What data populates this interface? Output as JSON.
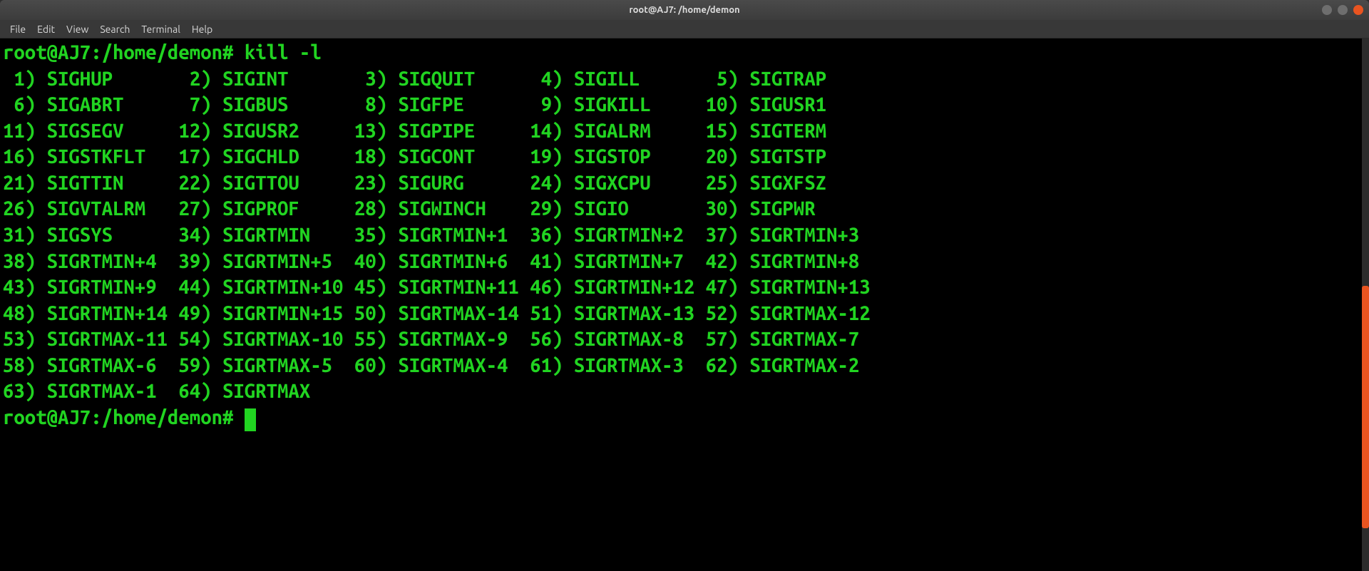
{
  "titlebar": {
    "title": "root@AJ7: /home/demon"
  },
  "menubar": {
    "items": [
      "File",
      "Edit",
      "View",
      "Search",
      "Terminal",
      "Help"
    ]
  },
  "terminal": {
    "prompt": "root@AJ7:/home/demon#",
    "command": "kill -l",
    "signals": [
      {
        "num": "1",
        "name": "SIGHUP"
      },
      {
        "num": "2",
        "name": "SIGINT"
      },
      {
        "num": "3",
        "name": "SIGQUIT"
      },
      {
        "num": "4",
        "name": "SIGILL"
      },
      {
        "num": "5",
        "name": "SIGTRAP"
      },
      {
        "num": "6",
        "name": "SIGABRT"
      },
      {
        "num": "7",
        "name": "SIGBUS"
      },
      {
        "num": "8",
        "name": "SIGFPE"
      },
      {
        "num": "9",
        "name": "SIGKILL"
      },
      {
        "num": "10",
        "name": "SIGUSR1"
      },
      {
        "num": "11",
        "name": "SIGSEGV"
      },
      {
        "num": "12",
        "name": "SIGUSR2"
      },
      {
        "num": "13",
        "name": "SIGPIPE"
      },
      {
        "num": "14",
        "name": "SIGALRM"
      },
      {
        "num": "15",
        "name": "SIGTERM"
      },
      {
        "num": "16",
        "name": "SIGSTKFLT"
      },
      {
        "num": "17",
        "name": "SIGCHLD"
      },
      {
        "num": "18",
        "name": "SIGCONT"
      },
      {
        "num": "19",
        "name": "SIGSTOP"
      },
      {
        "num": "20",
        "name": "SIGTSTP"
      },
      {
        "num": "21",
        "name": "SIGTTIN"
      },
      {
        "num": "22",
        "name": "SIGTTOU"
      },
      {
        "num": "23",
        "name": "SIGURG"
      },
      {
        "num": "24",
        "name": "SIGXCPU"
      },
      {
        "num": "25",
        "name": "SIGXFSZ"
      },
      {
        "num": "26",
        "name": "SIGVTALRM"
      },
      {
        "num": "27",
        "name": "SIGPROF"
      },
      {
        "num": "28",
        "name": "SIGWINCH"
      },
      {
        "num": "29",
        "name": "SIGIO"
      },
      {
        "num": "30",
        "name": "SIGPWR"
      },
      {
        "num": "31",
        "name": "SIGSYS"
      },
      {
        "num": "34",
        "name": "SIGRTMIN"
      },
      {
        "num": "35",
        "name": "SIGRTMIN+1"
      },
      {
        "num": "36",
        "name": "SIGRTMIN+2"
      },
      {
        "num": "37",
        "name": "SIGRTMIN+3"
      },
      {
        "num": "38",
        "name": "SIGRTMIN+4"
      },
      {
        "num": "39",
        "name": "SIGRTMIN+5"
      },
      {
        "num": "40",
        "name": "SIGRTMIN+6"
      },
      {
        "num": "41",
        "name": "SIGRTMIN+7"
      },
      {
        "num": "42",
        "name": "SIGRTMIN+8"
      },
      {
        "num": "43",
        "name": "SIGRTMIN+9"
      },
      {
        "num": "44",
        "name": "SIGRTMIN+10"
      },
      {
        "num": "45",
        "name": "SIGRTMIN+11"
      },
      {
        "num": "46",
        "name": "SIGRTMIN+12"
      },
      {
        "num": "47",
        "name": "SIGRTMIN+13"
      },
      {
        "num": "48",
        "name": "SIGRTMIN+14"
      },
      {
        "num": "49",
        "name": "SIGRTMIN+15"
      },
      {
        "num": "50",
        "name": "SIGRTMAX-14"
      },
      {
        "num": "51",
        "name": "SIGRTMAX-13"
      },
      {
        "num": "52",
        "name": "SIGRTMAX-12"
      },
      {
        "num": "53",
        "name": "SIGRTMAX-11"
      },
      {
        "num": "54",
        "name": "SIGRTMAX-10"
      },
      {
        "num": "55",
        "name": "SIGRTMAX-9"
      },
      {
        "num": "56",
        "name": "SIGRTMAX-8"
      },
      {
        "num": "57",
        "name": "SIGRTMAX-7"
      },
      {
        "num": "58",
        "name": "SIGRTMAX-6"
      },
      {
        "num": "59",
        "name": "SIGRTMAX-5"
      },
      {
        "num": "60",
        "name": "SIGRTMAX-4"
      },
      {
        "num": "61",
        "name": "SIGRTMAX-3"
      },
      {
        "num": "62",
        "name": "SIGRTMAX-2"
      },
      {
        "num": "63",
        "name": "SIGRTMAX-1"
      },
      {
        "num": "64",
        "name": "SIGRTMAX"
      }
    ],
    "columns_per_row": 5
  }
}
